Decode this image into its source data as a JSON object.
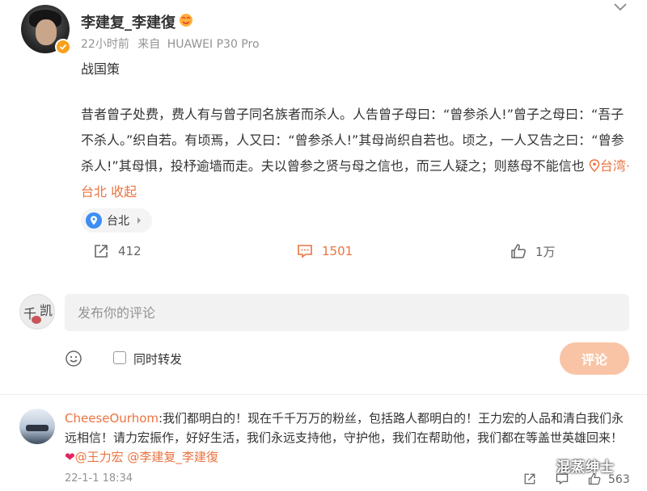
{
  "post": {
    "author": "李建复_李建復",
    "time": "22小时前",
    "source_prefix": "来自",
    "source_device": "HUAWEI P30 Pro",
    "title": "战国策",
    "body": "昔者曾子处费，费人有与曾子同名族者而杀人。人告曾子母曰：“曾参杀人!”曾子之母曰：“吾子不杀人。”织自若。有顷焉，人又曰：“曾参杀人!”其母尚织自若也。顷之，一人又告之曰：“曾参杀人!”其母惧，投杼逾墙而走。夫以曾参之贤与母之信也，而三人疑之；则慈母不能信也",
    "location_link": "台湾·台北",
    "collapse_link": "收起",
    "location_chip": "台北",
    "forward_count": "412",
    "comment_count": "1501",
    "like_count": "1万"
  },
  "compose": {
    "placeholder": "发布你的评论",
    "repost_label": "同时转发",
    "submit_label": "评论",
    "avatar_chars": [
      "千",
      "凯"
    ]
  },
  "comment": {
    "user": "CheeseOurhom",
    "text": ":我们都明白的！现在千千万万的粉丝，包括路人都明白的！王力宏的人品和清白我们永远相信！请力宏振作，好好生活，我们永远支持他，守护他，我们在帮助他，我们都在等盖世英雄回来！",
    "heart": "❤",
    "mention1": "@王力宏",
    "mention2": "@李建复_李建復",
    "time": "22-1-1 18:34",
    "like_count": "563"
  },
  "watermark": "混蒸绅士",
  "colors": {
    "accent": "#eb7340",
    "verified": "#f8a01c",
    "location_pin": "#3d8ef5",
    "submit_disabled": "#f9c4a6"
  },
  "icons": [
    "chevron-down-icon",
    "verified-icon",
    "fan-badge-icon",
    "location-pin-icon",
    "forward-icon",
    "comment-icon",
    "like-icon",
    "emoji-icon",
    "checkbox-icon"
  ]
}
